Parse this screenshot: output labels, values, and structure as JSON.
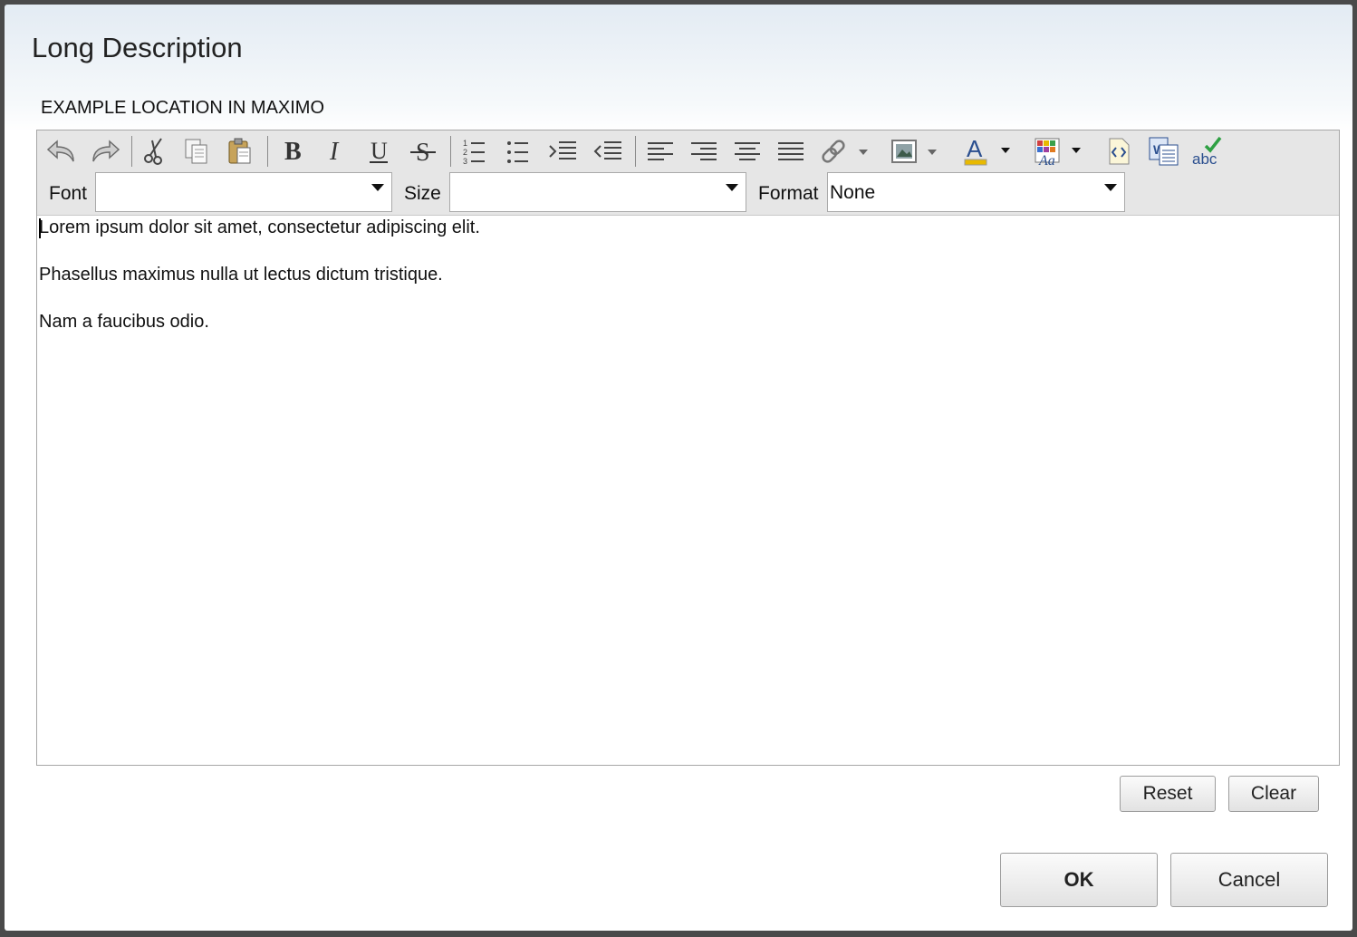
{
  "dialog": {
    "title": "Long Description",
    "field_label": "EXAMPLE LOCATION IN MAXIMO"
  },
  "toolbar": {
    "buttons": [
      {
        "name": "undo-icon"
      },
      {
        "name": "redo-icon"
      },
      {
        "name": "cut-icon"
      },
      {
        "name": "copy-icon"
      },
      {
        "name": "paste-icon"
      },
      {
        "name": "bold-icon"
      },
      {
        "name": "italic-icon"
      },
      {
        "name": "underline-icon"
      },
      {
        "name": "strikethrough-icon"
      },
      {
        "name": "numbered-list-icon"
      },
      {
        "name": "bullet-list-icon"
      },
      {
        "name": "indent-icon"
      },
      {
        "name": "outdent-icon"
      },
      {
        "name": "align-left-icon"
      },
      {
        "name": "align-right-icon"
      },
      {
        "name": "align-center-icon"
      },
      {
        "name": "align-justify-icon"
      },
      {
        "name": "link-icon"
      },
      {
        "name": "image-icon"
      },
      {
        "name": "text-color-icon"
      },
      {
        "name": "highlight-color-icon"
      },
      {
        "name": "source-view-icon"
      },
      {
        "name": "paste-from-word-icon"
      },
      {
        "name": "spellcheck-icon"
      }
    ],
    "font_label": "Font",
    "font_value": "",
    "size_label": "Size",
    "size_value": "",
    "format_label": "Format",
    "format_value": "None"
  },
  "content": {
    "paragraphs": [
      "Lorem ipsum dolor sit amet, consectetur adipiscing elit.",
      "Phasellus maximus nulla ut lectus dictum tristique.",
      "Nam a faucibus odio."
    ]
  },
  "buttons": {
    "reset": "Reset",
    "clear": "Clear",
    "ok": "OK",
    "cancel": "Cancel"
  },
  "colors": {
    "text_color_bar": "#e8b900",
    "icon_blue": "#2b4f8f",
    "spell_check_green": "#2ea043"
  }
}
